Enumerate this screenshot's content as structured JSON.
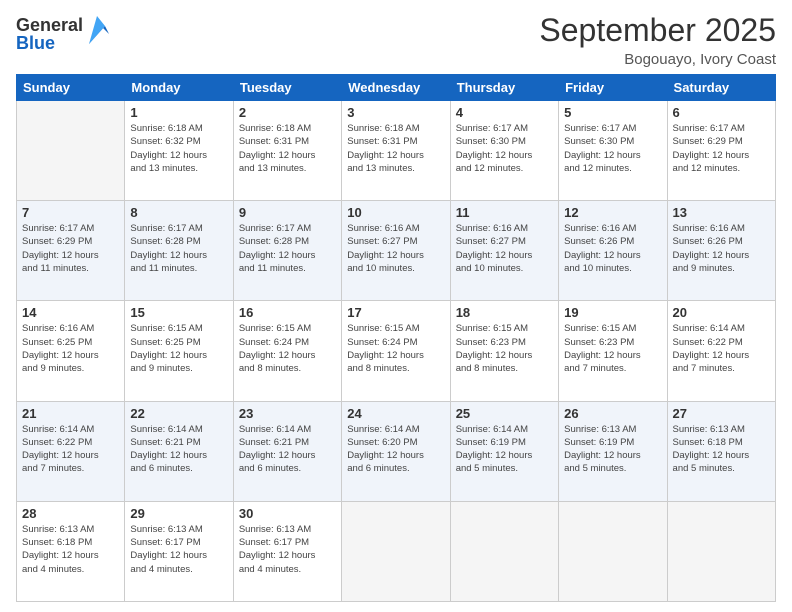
{
  "header": {
    "logo": {
      "general": "General",
      "blue": "Blue"
    },
    "title": "September 2025",
    "subtitle": "Bogouayo, Ivory Coast"
  },
  "weekdays": [
    "Sunday",
    "Monday",
    "Tuesday",
    "Wednesday",
    "Thursday",
    "Friday",
    "Saturday"
  ],
  "weeks": [
    [
      {
        "day": "",
        "info": ""
      },
      {
        "day": "1",
        "info": "Sunrise: 6:18 AM\nSunset: 6:32 PM\nDaylight: 12 hours\nand 13 minutes."
      },
      {
        "day": "2",
        "info": "Sunrise: 6:18 AM\nSunset: 6:31 PM\nDaylight: 12 hours\nand 13 minutes."
      },
      {
        "day": "3",
        "info": "Sunrise: 6:18 AM\nSunset: 6:31 PM\nDaylight: 12 hours\nand 13 minutes."
      },
      {
        "day": "4",
        "info": "Sunrise: 6:17 AM\nSunset: 6:30 PM\nDaylight: 12 hours\nand 12 minutes."
      },
      {
        "day": "5",
        "info": "Sunrise: 6:17 AM\nSunset: 6:30 PM\nDaylight: 12 hours\nand 12 minutes."
      },
      {
        "day": "6",
        "info": "Sunrise: 6:17 AM\nSunset: 6:29 PM\nDaylight: 12 hours\nand 12 minutes."
      }
    ],
    [
      {
        "day": "7",
        "info": "Sunrise: 6:17 AM\nSunset: 6:29 PM\nDaylight: 12 hours\nand 11 minutes."
      },
      {
        "day": "8",
        "info": "Sunrise: 6:17 AM\nSunset: 6:28 PM\nDaylight: 12 hours\nand 11 minutes."
      },
      {
        "day": "9",
        "info": "Sunrise: 6:17 AM\nSunset: 6:28 PM\nDaylight: 12 hours\nand 11 minutes."
      },
      {
        "day": "10",
        "info": "Sunrise: 6:16 AM\nSunset: 6:27 PM\nDaylight: 12 hours\nand 10 minutes."
      },
      {
        "day": "11",
        "info": "Sunrise: 6:16 AM\nSunset: 6:27 PM\nDaylight: 12 hours\nand 10 minutes."
      },
      {
        "day": "12",
        "info": "Sunrise: 6:16 AM\nSunset: 6:26 PM\nDaylight: 12 hours\nand 10 minutes."
      },
      {
        "day": "13",
        "info": "Sunrise: 6:16 AM\nSunset: 6:26 PM\nDaylight: 12 hours\nand 9 minutes."
      }
    ],
    [
      {
        "day": "14",
        "info": "Sunrise: 6:16 AM\nSunset: 6:25 PM\nDaylight: 12 hours\nand 9 minutes."
      },
      {
        "day": "15",
        "info": "Sunrise: 6:15 AM\nSunset: 6:25 PM\nDaylight: 12 hours\nand 9 minutes."
      },
      {
        "day": "16",
        "info": "Sunrise: 6:15 AM\nSunset: 6:24 PM\nDaylight: 12 hours\nand 8 minutes."
      },
      {
        "day": "17",
        "info": "Sunrise: 6:15 AM\nSunset: 6:24 PM\nDaylight: 12 hours\nand 8 minutes."
      },
      {
        "day": "18",
        "info": "Sunrise: 6:15 AM\nSunset: 6:23 PM\nDaylight: 12 hours\nand 8 minutes."
      },
      {
        "day": "19",
        "info": "Sunrise: 6:15 AM\nSunset: 6:23 PM\nDaylight: 12 hours\nand 7 minutes."
      },
      {
        "day": "20",
        "info": "Sunrise: 6:14 AM\nSunset: 6:22 PM\nDaylight: 12 hours\nand 7 minutes."
      }
    ],
    [
      {
        "day": "21",
        "info": "Sunrise: 6:14 AM\nSunset: 6:22 PM\nDaylight: 12 hours\nand 7 minutes."
      },
      {
        "day": "22",
        "info": "Sunrise: 6:14 AM\nSunset: 6:21 PM\nDaylight: 12 hours\nand 6 minutes."
      },
      {
        "day": "23",
        "info": "Sunrise: 6:14 AM\nSunset: 6:21 PM\nDaylight: 12 hours\nand 6 minutes."
      },
      {
        "day": "24",
        "info": "Sunrise: 6:14 AM\nSunset: 6:20 PM\nDaylight: 12 hours\nand 6 minutes."
      },
      {
        "day": "25",
        "info": "Sunrise: 6:14 AM\nSunset: 6:19 PM\nDaylight: 12 hours\nand 5 minutes."
      },
      {
        "day": "26",
        "info": "Sunrise: 6:13 AM\nSunset: 6:19 PM\nDaylight: 12 hours\nand 5 minutes."
      },
      {
        "day": "27",
        "info": "Sunrise: 6:13 AM\nSunset: 6:18 PM\nDaylight: 12 hours\nand 5 minutes."
      }
    ],
    [
      {
        "day": "28",
        "info": "Sunrise: 6:13 AM\nSunset: 6:18 PM\nDaylight: 12 hours\nand 4 minutes."
      },
      {
        "day": "29",
        "info": "Sunrise: 6:13 AM\nSunset: 6:17 PM\nDaylight: 12 hours\nand 4 minutes."
      },
      {
        "day": "30",
        "info": "Sunrise: 6:13 AM\nSunset: 6:17 PM\nDaylight: 12 hours\nand 4 minutes."
      },
      {
        "day": "",
        "info": ""
      },
      {
        "day": "",
        "info": ""
      },
      {
        "day": "",
        "info": ""
      },
      {
        "day": "",
        "info": ""
      }
    ]
  ]
}
